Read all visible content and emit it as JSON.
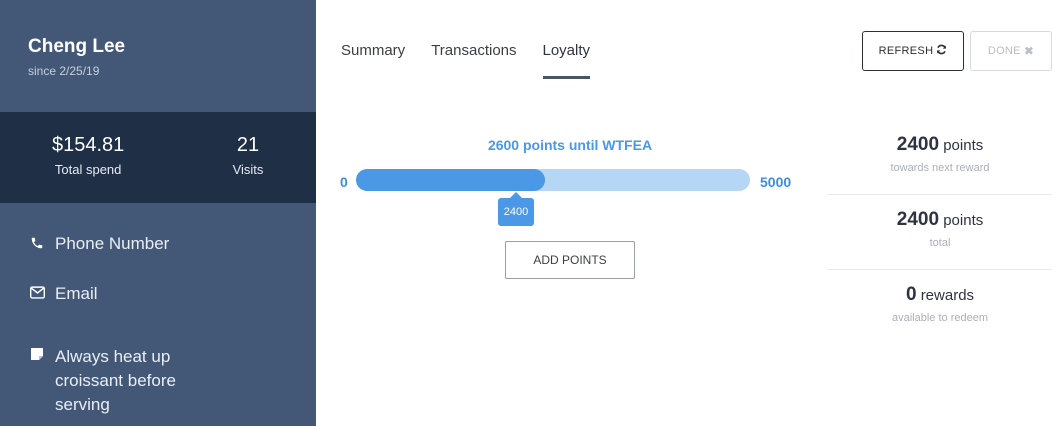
{
  "customer": {
    "name": "Cheng Lee",
    "since": "since 2/25/19"
  },
  "stats": {
    "spend_value": "$154.81",
    "spend_label": "Total spend",
    "visits_value": "21",
    "visits_label": "Visits"
  },
  "contact": {
    "phone": "Phone Number",
    "email": "Email",
    "note": "Always heat up\ncroissant before\nserving"
  },
  "tabs": [
    {
      "label": "Summary",
      "active": false
    },
    {
      "label": "Transactions",
      "active": false
    },
    {
      "label": "Loyalty",
      "active": true
    }
  ],
  "toolbar": {
    "refresh_label": "REFRESH",
    "done_label": "DONE"
  },
  "loyalty": {
    "goal_text": "2600 points until WTFEA",
    "min": "0",
    "max": "5000",
    "current": 2400,
    "current_label": "2400",
    "add_points_label": "ADD POINTS"
  },
  "summary": [
    {
      "number": "2400",
      "unit": "points",
      "sub": "towards next reward"
    },
    {
      "number": "2400",
      "unit": "points",
      "sub": "total"
    },
    {
      "number": "0",
      "unit": "rewards",
      "sub": "available to redeem"
    }
  ],
  "colors": {
    "sidebar": "#435877",
    "stats_band": "#1f2f46",
    "accent": "#4a98e6",
    "track": "#b5d6f5"
  },
  "icons": {
    "phone": "phone-icon",
    "email": "envelope-icon",
    "note": "note-icon",
    "refresh": "refresh-icon",
    "done": "close-icon"
  }
}
